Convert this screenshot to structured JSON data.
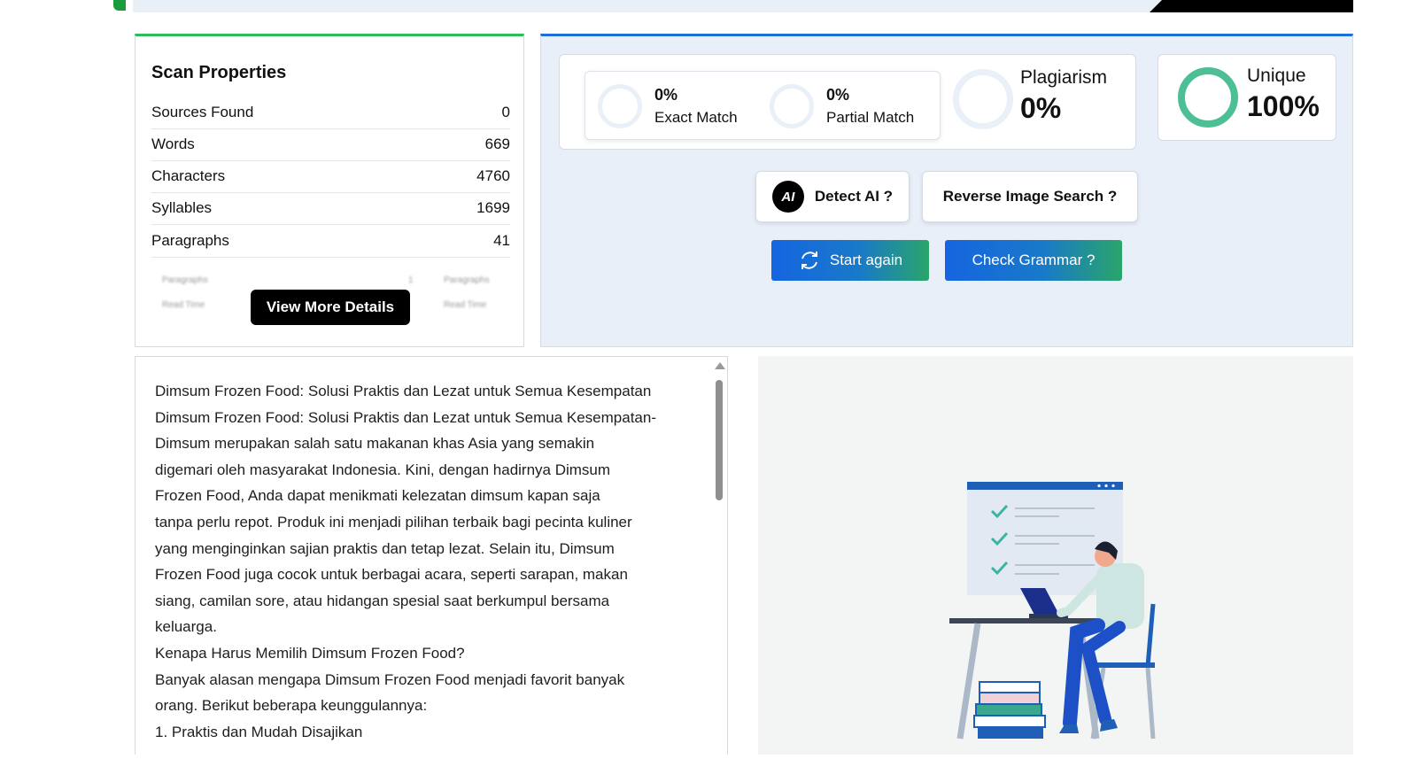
{
  "scan_properties": {
    "title": "Scan Properties",
    "rows": [
      {
        "label": "Sources Found",
        "value": "0"
      },
      {
        "label": "Words",
        "value": "669"
      },
      {
        "label": "Characters",
        "value": "4760"
      },
      {
        "label": "Syllables",
        "value": "1699"
      },
      {
        "label": "Paragraphs",
        "value": "41"
      }
    ],
    "blurred": {
      "left_top": "Paragraphs",
      "left_top_value": "1",
      "left_bottom": "Read Time",
      "right_top": "Paragraphs",
      "right_bottom": "Read Time"
    },
    "view_more_label": "View More Details"
  },
  "results": {
    "exact_match": {
      "value": "0%",
      "label": "Exact Match"
    },
    "partial_match": {
      "value": "0%",
      "label": "Partial Match"
    },
    "plagiarism": {
      "label": "Plagiarism",
      "value": "0%"
    },
    "unique": {
      "label": "Unique",
      "value": "100%"
    },
    "detect_ai_label": "Detect AI ?",
    "ai_badge": "AI",
    "reverse_image_label": "Reverse Image Search ?",
    "start_again_label": "Start again",
    "check_grammar_label": "Check Grammar ?"
  },
  "colors": {
    "accent_blue": "#1565e0",
    "accent_green": "#2aa56a",
    "unique_ring": "#4cbf95",
    "check_teal": "#3bb5a3"
  },
  "editor": {
    "lines": [
      "Dimsum Frozen Food: Solusi Praktis dan Lezat untuk Semua Kesempatan",
      "Dimsum Frozen Food: Solusi Praktis dan Lezat untuk Semua Kesempatan-",
      "Dimsum merupakan salah satu makanan khas Asia yang semakin",
      "digemari oleh masyarakat Indonesia. Kini, dengan hadirnya Dimsum",
      "Frozen Food, Anda dapat menikmati kelezatan dimsum kapan saja",
      "tanpa perlu repot. Produk ini menjadi pilihan terbaik bagi pecinta kuliner",
      "yang menginginkan sajian praktis dan tetap lezat. Selain itu, Dimsum",
      "Frozen Food juga cocok untuk berbagai acara, seperti sarapan, makan",
      "siang, camilan sore, atau hidangan spesial saat berkumpul bersama",
      "keluarga.",
      "Kenapa Harus Memilih Dimsum Frozen Food?",
      "Banyak alasan mengapa Dimsum Frozen Food menjadi favorit banyak",
      "orang. Berikut beberapa keunggulannya:",
      "1. Praktis dan Mudah Disajikan"
    ]
  }
}
